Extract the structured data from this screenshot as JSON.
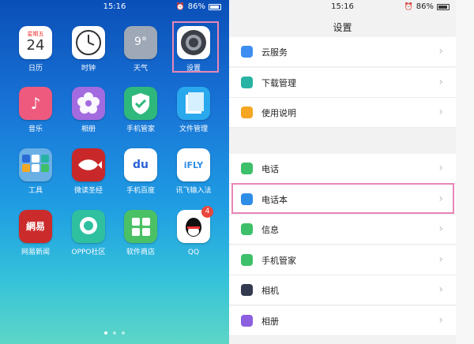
{
  "left": {
    "status": {
      "time": "15:16",
      "battery": "86%"
    },
    "apps": [
      {
        "label": "日历",
        "icon": "calendar-icon",
        "color": "#ffffff",
        "text1": "星期五",
        "text2": "24"
      },
      {
        "label": "时钟",
        "icon": "clock-icon",
        "color": "#ffffff"
      },
      {
        "label": "天气",
        "icon": "weather-icon",
        "color": "#9ea8b6",
        "text1": "9°"
      },
      {
        "label": "设置",
        "icon": "gear-icon",
        "color": "#ffffff"
      },
      {
        "label": "音乐",
        "icon": "music-icon",
        "color": "#ee5a7e"
      },
      {
        "label": "相册",
        "icon": "flower-icon",
        "color": "#a36be0"
      },
      {
        "label": "手机管家",
        "icon": "shield-icon",
        "color": "#2fb87b"
      },
      {
        "label": "文件管理",
        "icon": "file-icon",
        "color": "#2aa8ee"
      },
      {
        "label": "工具",
        "icon": "tools-folder-icon",
        "color": "#6ab0e5"
      },
      {
        "label": "微读圣经",
        "icon": "fish-icon",
        "color": "#c8282a"
      },
      {
        "label": "手机百度",
        "icon": "baidu-icon",
        "color": "#ffffff",
        "text1": "du"
      },
      {
        "label": "讯飞输入法",
        "icon": "ifly-icon",
        "color": "#ffffff",
        "text1": "iFLY"
      },
      {
        "label": "网易新闻",
        "icon": "netease-icon",
        "color": "#cc2b2b",
        "text1": "網易"
      },
      {
        "label": "OPPO社区",
        "icon": "chat-icon",
        "color": "#2fc0a0"
      },
      {
        "label": "软件商店",
        "icon": "store-icon",
        "color": "#4bc166"
      },
      {
        "label": "QQ",
        "icon": "qq-icon",
        "color": "#ffffff",
        "badge": "4"
      }
    ]
  },
  "right": {
    "status": {
      "time": "15:16",
      "battery": "86%"
    },
    "title": "设置",
    "rows": [
      {
        "label": "云服务",
        "icon": "cloud-icon",
        "color": "#3d8ef0"
      },
      {
        "label": "下载管理",
        "icon": "download-icon",
        "color": "#27b3a3"
      },
      {
        "label": "使用说明",
        "icon": "bulb-icon",
        "color": "#f5a623"
      },
      {
        "label": "电话",
        "icon": "phone-icon",
        "color": "#3ec06a"
      },
      {
        "label": "电话本",
        "icon": "contacts-icon",
        "color": "#2e8de6"
      },
      {
        "label": "信息",
        "icon": "message-icon",
        "color": "#3ec06a"
      },
      {
        "label": "手机管家",
        "icon": "shield-icon",
        "color": "#3ec06a"
      },
      {
        "label": "相机",
        "icon": "camera-icon",
        "color": "#333a4f"
      },
      {
        "label": "相册",
        "icon": "album-icon",
        "color": "#8b5fe0"
      }
    ]
  }
}
